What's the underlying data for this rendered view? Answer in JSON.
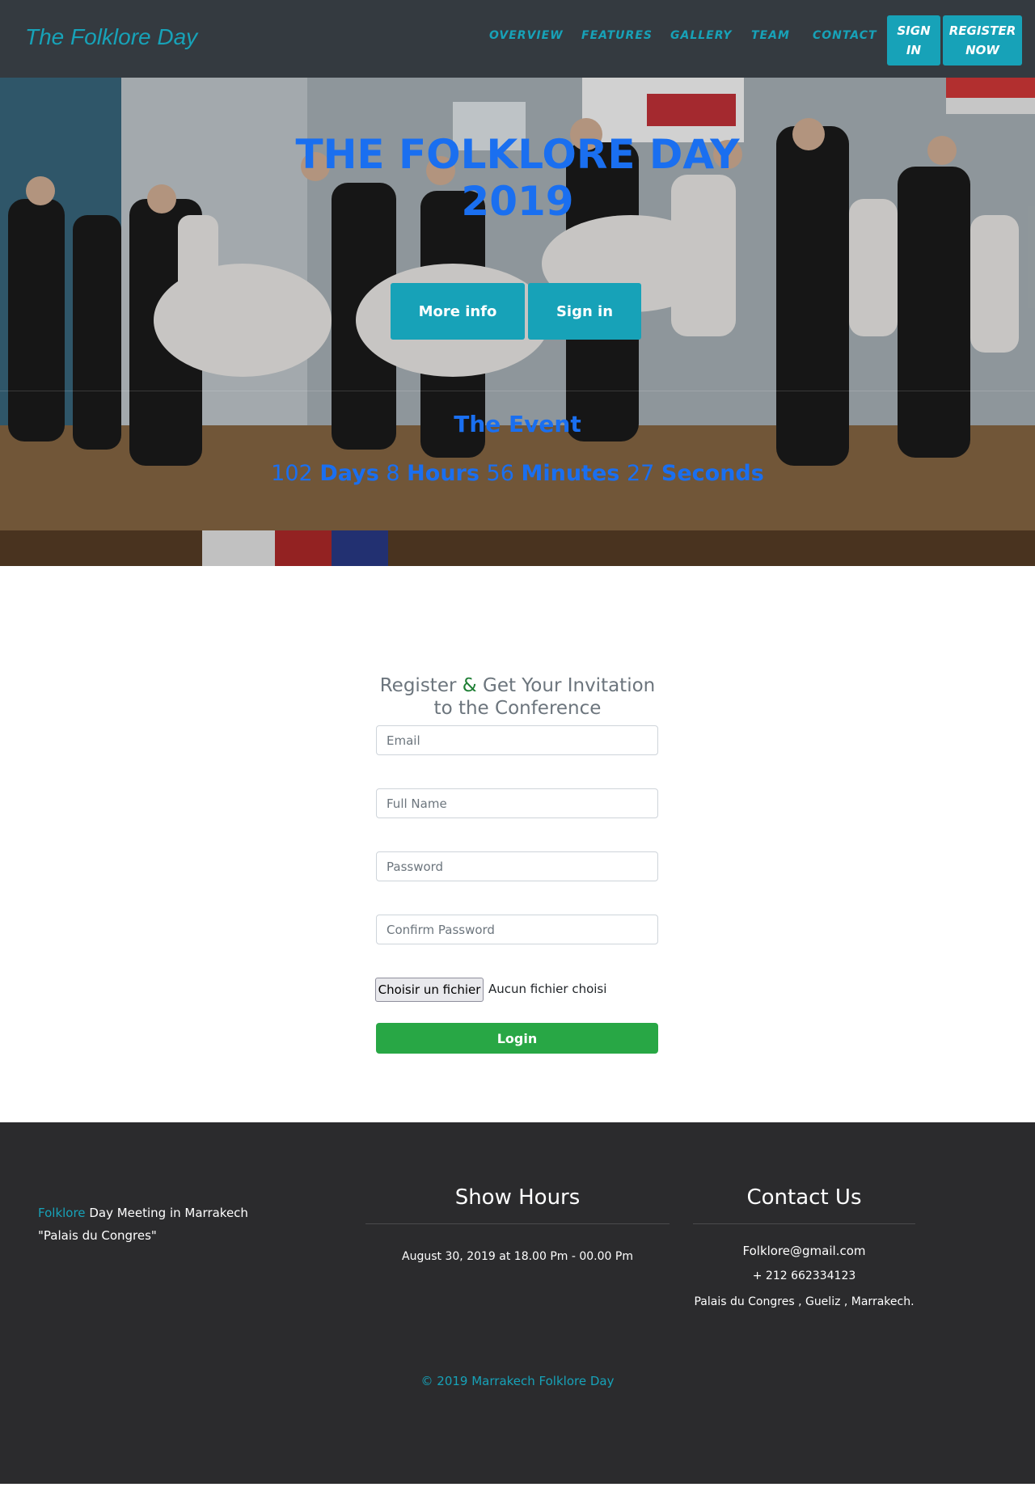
{
  "navbar": {
    "brand": "The Folklore Day",
    "links": [
      "OVERVIEW",
      "FEATURES",
      "GALLERY",
      "TEAM",
      "CONTACT"
    ],
    "sign_in_line1": "SIGN",
    "sign_in_line2": "IN",
    "register_line1": "REGISTER",
    "register_line2": "NOW",
    "colors": {
      "background": "#343a40",
      "accent": "#17a2b8"
    }
  },
  "hero": {
    "title_line1": "THE FOLKLORE DAY",
    "title_line2": "2019",
    "more_info_label": "More info",
    "sign_in_label": "Sign in",
    "event_title": "The Event",
    "countdown": {
      "days_value": "102",
      "days_label": "Days",
      "hours_value": "8",
      "hours_label": "Hours",
      "minutes_value": "56",
      "minutes_label": "Minutes",
      "seconds_value": "27",
      "seconds_label": "Seconds"
    },
    "colors": {
      "title": "#1a6ff0",
      "button": "#17a2b8"
    }
  },
  "register": {
    "heading_part1": "Register",
    "heading_amp": "&",
    "heading_part2": "Get Your Invitation",
    "heading_line2": "to the Conference",
    "email_placeholder": "Email",
    "fullname_placeholder": "Full Name",
    "password_placeholder": "Password",
    "confirm_placeholder": "Confirm Password",
    "file_button_label": "Choisir un fichier",
    "file_status": "Aucun fichier choisi",
    "submit_label": "Login",
    "colors": {
      "submit": "#28a745",
      "heading": "#6c757d",
      "ampersand": "#1e7e34"
    }
  },
  "footer": {
    "about_highlight": "Folklore",
    "about_rest": "Day Meeting in Marrakech",
    "about_line2": "\"Palais du Congres\"",
    "hours_title": "Show Hours",
    "hours_text": "August 30, 2019 at 18.00 Pm - 00.00 Pm",
    "contact_title": "Contact Us",
    "contact_email": "Folklore@gmail.com",
    "contact_phone": "+ 212 662334123",
    "contact_address": "Palais du Congres , Gueliz , Marrakech.",
    "copyright": "© 2019 Marrakech Folklore Day",
    "colors": {
      "background": "#2b2b2d"
    }
  }
}
